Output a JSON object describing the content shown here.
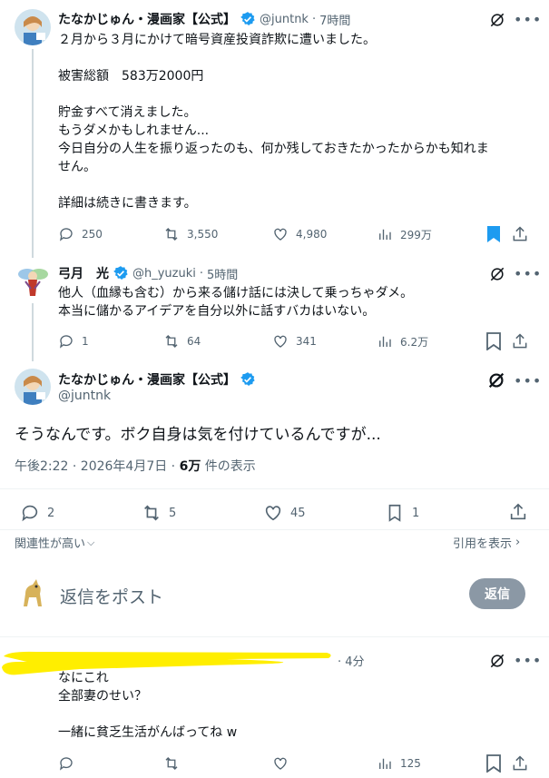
{
  "tweet1": {
    "name": "たなかじゅん・漫画家【公式】",
    "handle": "@juntnk",
    "time": "7時間",
    "lines": [
      "２月から３月にかけて暗号資産投資詐欺に遭いました。",
      "",
      "被害総額　583万2000円",
      "",
      "貯金すべて消えました。",
      "もうダメかもしれません...",
      "今日自分の人生を振り返ったのも、何か残しておきたかったからかも知れま",
      "せん。",
      "",
      "詳細は続きに書きます。"
    ],
    "replies": "250",
    "reposts": "3,550",
    "likes": "4,980",
    "views": "299万"
  },
  "tweet2": {
    "name": "弓月　光",
    "handle": "@h_yuzuki",
    "time": "5時間",
    "lines": [
      "他人（血縁も含む）から来る儲け話には決して乗っちゃダメ。",
      "本当に儲かるアイデアを自分以外に話すバカはいない。"
    ],
    "replies": "1",
    "reposts": "64",
    "likes": "341",
    "views": "6.2万"
  },
  "main": {
    "name": "たなかじゅん・漫画家【公式】",
    "handle": "@juntnk",
    "text": "そうなんです。ボク自身は気を付けているんですが...",
    "timestamp": "午後2:22 · 2026年4月7日 · ",
    "views_count": "6万",
    "views_label": " 件の表示",
    "replies": "2",
    "reposts": "5",
    "likes": "45",
    "bookmarks": "1"
  },
  "sort": {
    "relevance": "関連性が高い",
    "quote": "引用を表示"
  },
  "composer": {
    "placeholder": "返信をポスト",
    "button": "返信"
  },
  "tweet3": {
    "time": "· 4分",
    "lines": [
      "なにこれ",
      "全部妻のせい？",
      "",
      "一緒に貧乏生活がんばってね w"
    ],
    "views": "125"
  },
  "colors": {
    "accent": "#1d9bf0",
    "text": "#0f1419",
    "muted": "#536471",
    "highlight": "#ffee00"
  }
}
